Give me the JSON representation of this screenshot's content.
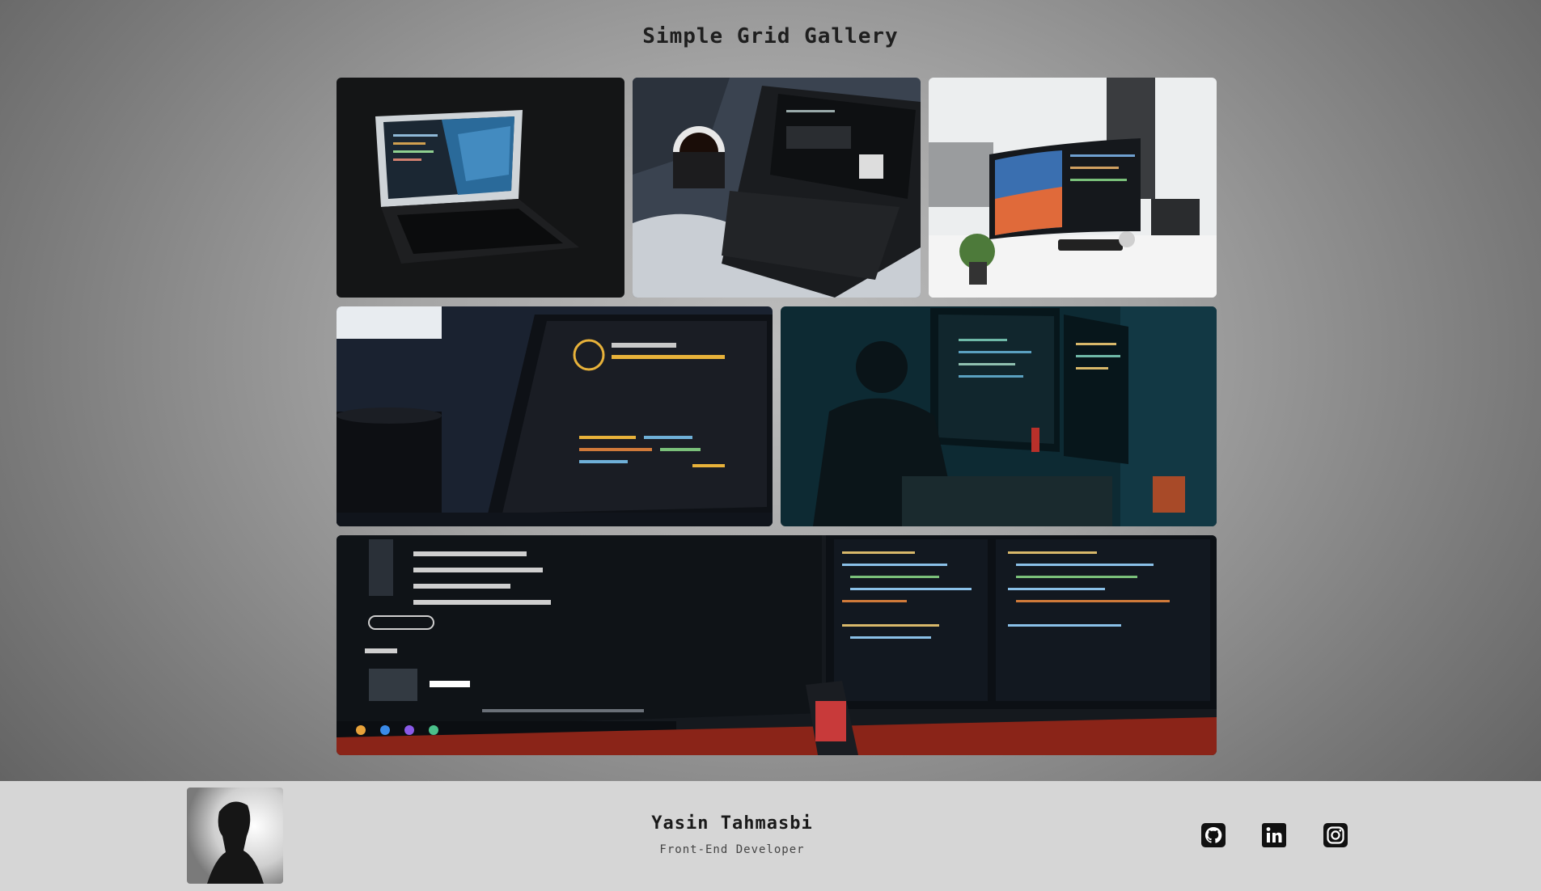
{
  "gallery": {
    "title": "Simple Grid Gallery",
    "images": [
      {
        "id": "laptop-ocean",
        "subject": "laptop with ocean wallpaper"
      },
      {
        "id": "laptop-coffee",
        "subject": "laptop and coffee mug on bed"
      },
      {
        "id": "curved-monitor",
        "subject": "curved monitor desk setup"
      },
      {
        "id": "laptop-editor",
        "subject": "laptop showing code editor with mug"
      },
      {
        "id": "developer-dark-room",
        "subject": "developer at dual monitors"
      },
      {
        "id": "monitors-music-code",
        "subject": "music app and code editor monitors"
      }
    ]
  },
  "footer": {
    "name": "Yasin Tahmasbi",
    "role": "Front-End Developer",
    "social": [
      "github-icon",
      "linkedin-icon",
      "instagram-icon"
    ]
  },
  "colors": {
    "background_center": "#bdbdbd",
    "background_edge": "#606060",
    "footer_bg": "#d6d6d6",
    "title_text": "#1f1f1f",
    "icon": "#111111"
  }
}
